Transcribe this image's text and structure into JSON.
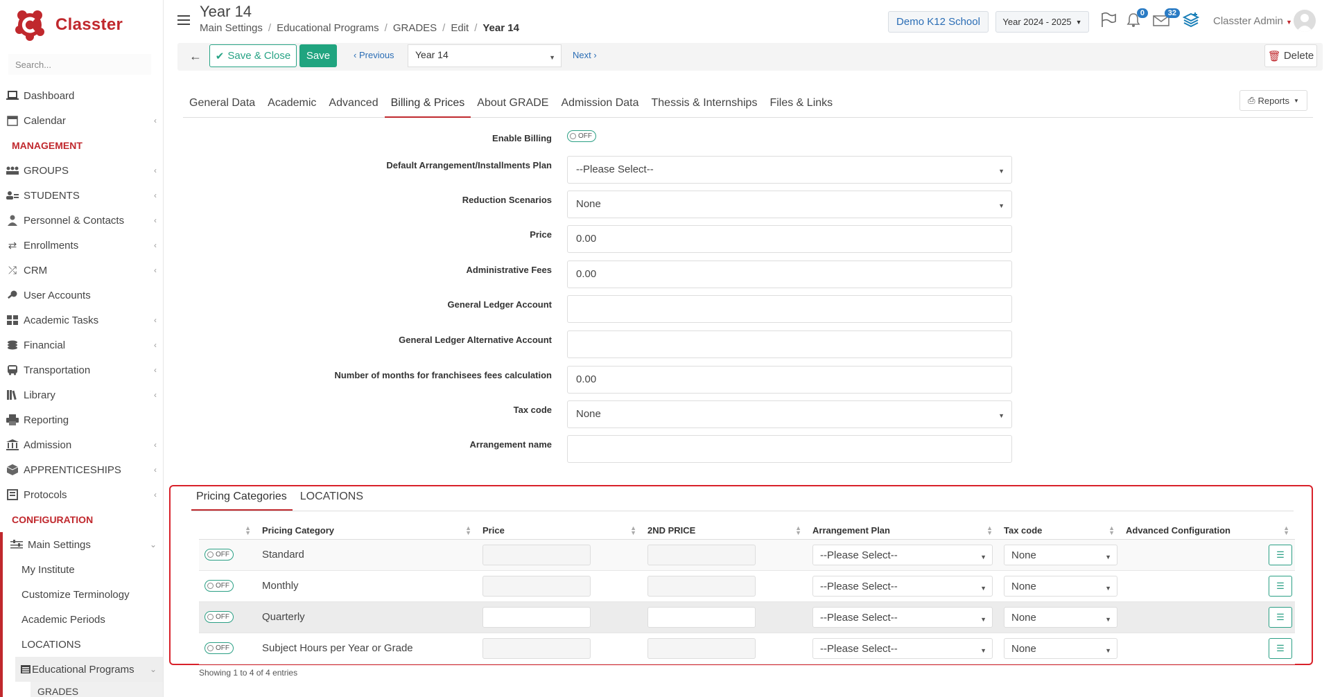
{
  "app": {
    "name": "Classter"
  },
  "sidebar": {
    "search_placeholder": "Search...",
    "items": [
      {
        "label": "Dashboard",
        "icon": "laptop-icon",
        "chevron": false
      },
      {
        "label": "Calendar",
        "icon": "calendar-icon",
        "chevron": true
      }
    ],
    "management_heading": "MANAGEMENT",
    "management": [
      {
        "label": "GROUPS",
        "icon": "groups-icon"
      },
      {
        "label": "STUDENTS",
        "icon": "students-icon"
      },
      {
        "label": "Personnel & Contacts",
        "icon": "person-icon"
      },
      {
        "label": "Enrollments",
        "icon": "exchange-icon"
      },
      {
        "label": "CRM",
        "icon": "crm-icon"
      },
      {
        "label": "User Accounts",
        "icon": "key-icon",
        "nochev": true
      },
      {
        "label": "Academic Tasks",
        "icon": "grid-icon"
      },
      {
        "label": "Financial",
        "icon": "coins-icon"
      },
      {
        "label": "Transportation",
        "icon": "bus-icon"
      },
      {
        "label": "Library",
        "icon": "books-icon"
      },
      {
        "label": "Reporting",
        "icon": "print-icon",
        "nochev": true
      },
      {
        "label": "Admission",
        "icon": "institution-icon"
      },
      {
        "label": "APPRENTICESHIPS",
        "icon": "box-icon"
      },
      {
        "label": "Protocols",
        "icon": "protocol-icon"
      }
    ],
    "configuration_heading": "CONFIGURATION",
    "main_settings": "Main Settings",
    "settings_children": [
      "My Institute",
      "Customize Terminology",
      "Academic Periods",
      "LOCATIONS"
    ],
    "educational_programs": "Educational Programs",
    "grades": "GRADES"
  },
  "header": {
    "title": "Year 14",
    "breadcrumbs": [
      "Main Settings",
      "Educational Programs",
      "GRADES",
      "Edit"
    ],
    "breadcrumb_current": "Year 14",
    "school": "Demo K12 School",
    "year": "Year 2024 - 2025",
    "notifications_count": "0",
    "messages_count": "32",
    "user": "Classter Admin"
  },
  "toolbar": {
    "save_close": "Save & Close",
    "save": "Save",
    "previous": "Previous",
    "record_select": "Year 14",
    "next": "Next",
    "delete": "Delete"
  },
  "tabs": [
    "General Data",
    "Academic",
    "Advanced",
    "Billing & Prices",
    "About GRADE",
    "Admission Data",
    "Thessis & Internships",
    "Files & Links"
  ],
  "active_tab": "Billing & Prices",
  "reports": "Reports",
  "form": {
    "enable_billing_label": "Enable Billing",
    "toggle_off": "OFF",
    "fields": [
      {
        "label": "Default Arrangement/Installments Plan",
        "value": "--Please Select--",
        "select": true
      },
      {
        "label": "Reduction Scenarios",
        "value": "None",
        "select": true
      },
      {
        "label": "Price",
        "value": "0.00",
        "select": false
      },
      {
        "label": "Administrative Fees",
        "value": "0.00",
        "select": false
      },
      {
        "label": "General Ledger Account",
        "value": "",
        "select": false
      },
      {
        "label": "General Ledger Alternative Account",
        "value": "",
        "select": false
      },
      {
        "label": "Number of months for franchisees fees calculation",
        "value": "0.00",
        "select": false
      },
      {
        "label": "Tax code",
        "value": "None",
        "select": true
      },
      {
        "label": "Arrangement name",
        "value": "",
        "select": false
      }
    ]
  },
  "pricing": {
    "tabs": [
      "Pricing Categories",
      "LOCATIONS"
    ],
    "columns": [
      "",
      "Pricing Category",
      "Price",
      "2ND PRICE",
      "Arrangement Plan",
      "Tax code",
      "Advanced Configuration"
    ],
    "rows": [
      {
        "toggle": "OFF",
        "category": "Standard",
        "plan": "--Please Select--",
        "tax": "None"
      },
      {
        "toggle": "OFF",
        "category": "Monthly",
        "plan": "--Please Select--",
        "tax": "None"
      },
      {
        "toggle": "OFF",
        "category": "Quarterly",
        "plan": "--Please Select--",
        "tax": "None"
      },
      {
        "toggle": "OFF",
        "category": "Subject Hours per Year or Grade",
        "plan": "--Please Select--",
        "tax": "None"
      }
    ],
    "entries_text": "Showing 1 to 4 of 4 entries"
  },
  "colors": {
    "brand": "#c0282d",
    "accent": "#20a47f",
    "link": "#2a6db5",
    "highlight_border": "#d8212a"
  }
}
